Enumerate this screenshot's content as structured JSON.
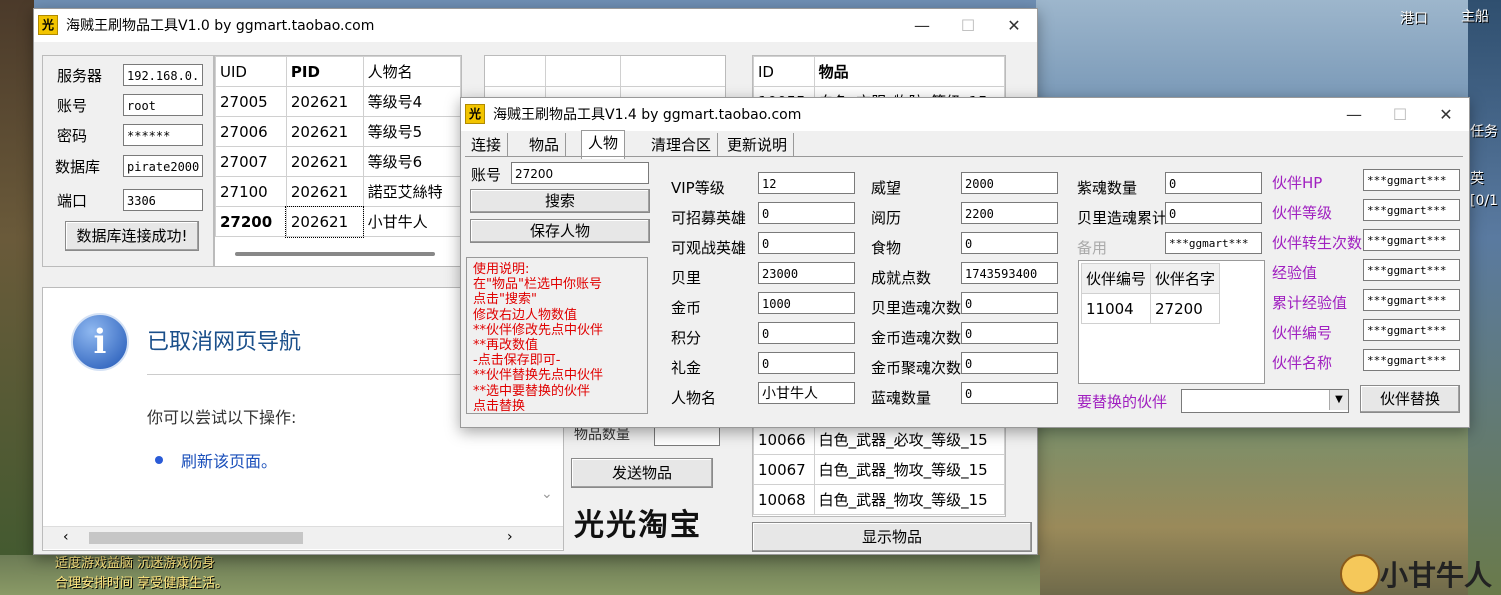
{
  "back_window": {
    "title": "海贼王刷物品工具V1.0 by ggmart.taobao.com",
    "server_label": "服务器",
    "server_value": "192.168.0.",
    "account_label": "账号",
    "account_value": "root",
    "password_label": "密码",
    "password_value": "******",
    "database_label": "数据库",
    "database_value": "pirate2000",
    "port_label": "端口",
    "port_value": "3306",
    "connect_button": "数据库连接成功!",
    "player_table": {
      "headers": [
        "UID",
        "PID",
        "人物名"
      ],
      "rows": [
        [
          "27005",
          "202621",
          "等级号4"
        ],
        [
          "27006",
          "202621",
          "等级号5"
        ],
        [
          "27007",
          "202621",
          "等级号6"
        ],
        [
          "27100",
          "202621",
          "諾亞艾絲特"
        ],
        [
          "27200",
          "202621",
          "小甘牛人"
        ]
      ]
    },
    "browser_error_title": "已取消网页导航",
    "browser_error_hint": "你可以尝试以下操作:",
    "browser_refresh_link": "刷新该页面。",
    "item_count_label": "物品数量",
    "send_button": "发送物品",
    "shop_logo": "光光淘宝",
    "items_table": {
      "headers": [
        "ID",
        "物品"
      ],
      "rows": [
        [
          "10055",
          "白色_衣服_物防_等级_15"
        ],
        [
          "10066",
          "白色_武器_必攻_等级_15"
        ],
        [
          "10067",
          "白色_武器_物攻_等级_15"
        ],
        [
          "10068",
          "白色_武器_物攻_等级_15"
        ]
      ]
    },
    "show_items_button": "显示物品"
  },
  "front_window": {
    "title": "海贼王刷物品工具V1.4 by ggmart.taobao.com",
    "tabs": [
      "连接",
      "物品",
      "人物",
      "清理合区",
      "更新说明"
    ],
    "active_tab": "人物",
    "account_label": "账号",
    "account_value": "27200",
    "search_button": "搜索",
    "save_button": "保存人物",
    "instructions": [
      "使用说明:",
      "在\"物品\"栏选中你账号",
      "点击\"搜索\"",
      "修改右边人物数值",
      "**伙伴修改先点中伙伴",
      "**再改数值",
      "-点击保存即可-",
      "**伙伴替换先点中伙伴",
      "**选中要替换的伙伴",
      "点击替换"
    ],
    "col1": [
      {
        "label": "VIP等级",
        "value": "12"
      },
      {
        "label": "可招募英雄",
        "value": "0"
      },
      {
        "label": "可观战英雄",
        "value": "0"
      },
      {
        "label": "贝里",
        "value": "23000"
      },
      {
        "label": "金币",
        "value": "1000"
      },
      {
        "label": "积分",
        "value": "0"
      },
      {
        "label": "礼金",
        "value": "0"
      },
      {
        "label": "人物名",
        "value": "小甘牛人"
      }
    ],
    "col2": [
      {
        "label": "威望",
        "value": "2000"
      },
      {
        "label": "阅历",
        "value": "2200"
      },
      {
        "label": "食物",
        "value": "0"
      },
      {
        "label": "成就点数",
        "value": "1743593400"
      },
      {
        "label": "贝里造魂次数",
        "value": "0"
      },
      {
        "label": "金币造魂次数",
        "value": "0"
      },
      {
        "label": "金币聚魂次数",
        "value": "0"
      },
      {
        "label": "蓝魂数量",
        "value": "0"
      }
    ],
    "col3": [
      {
        "label": "紫魂数量",
        "value": "0"
      },
      {
        "label": "贝里造魂累计",
        "value": "0"
      },
      {
        "label": "备用",
        "value": "***ggmart***"
      }
    ],
    "partner_table": {
      "headers": [
        "伙伴编号",
        "伙伴名字"
      ],
      "rows": [
        [
          "11004",
          "27200"
        ]
      ]
    },
    "partner_fields": [
      {
        "label": "伙伴HP",
        "value": "***ggmart***"
      },
      {
        "label": "伙伴等级",
        "value": "***ggmart***"
      },
      {
        "label": "伙伴转生次数",
        "value": "***ggmart***"
      },
      {
        "label": "经验值",
        "value": "***ggmart***"
      },
      {
        "label": "累计经验值",
        "value": "***ggmart***"
      },
      {
        "label": "伙伴编号",
        "value": "***ggmart***"
      },
      {
        "label": "伙伴名称",
        "value": "***ggmart***"
      }
    ],
    "replace_label": "要替换的伙伴",
    "replace_select_value": "",
    "replace_button": "伙伴替换"
  },
  "game": {
    "top_right_labels": [
      "港口",
      "主船"
    ],
    "right_labels": [
      "任务",
      "英",
      "[0/1"
    ],
    "bottom_notice": [
      "适度游戏益脑 沉迷游戏伤身",
      "合理安排时间 享受健康生活。"
    ],
    "watermark": "小甘牛人"
  }
}
